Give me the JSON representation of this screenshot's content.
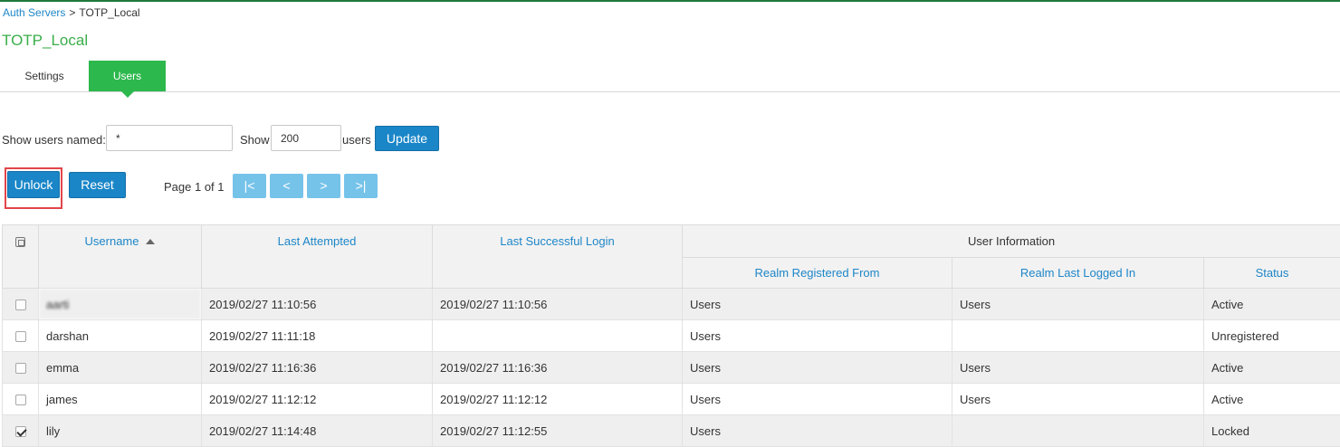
{
  "breadcrumb": {
    "parent": "Auth Servers",
    "separator": ">",
    "current": "TOTP_Local"
  },
  "page_title": "TOTP_Local",
  "tabs": [
    {
      "label": "Settings",
      "active": false
    },
    {
      "label": "Users",
      "active": true
    }
  ],
  "filter": {
    "show_users_named_label": "Show users named:",
    "name_value": "*",
    "show_label": "Show",
    "count_value": "200",
    "users_label": "users",
    "update_button": "Update"
  },
  "actions": {
    "unlock_button": "Unlock",
    "reset_button": "Reset"
  },
  "pager": {
    "text": "Page 1 of 1",
    "first": "|<",
    "prev": "<",
    "next": ">",
    "last": ">|"
  },
  "table": {
    "headers": {
      "username": "Username",
      "last_attempted": "Last Attempted",
      "last_successful_login": "Last Successful Login",
      "user_information": "User Information",
      "realm_registered_from": "Realm Registered From",
      "realm_last_logged_in": "Realm Last Logged In",
      "status": "Status"
    },
    "rows": [
      {
        "checked": false,
        "username": "aarti",
        "last_attempted": "2019/02/27 11:10:56",
        "last_successful": "2019/02/27 11:10:56",
        "realm_registered": "Users",
        "realm_last": "Users",
        "status": "Active"
      },
      {
        "checked": false,
        "username": "darshan",
        "last_attempted": "2019/02/27 11:11:18",
        "last_successful": "",
        "realm_registered": "Users",
        "realm_last": "",
        "status": "Unregistered"
      },
      {
        "checked": false,
        "username": "emma",
        "last_attempted": "2019/02/27 11:16:36",
        "last_successful": "2019/02/27 11:16:36",
        "realm_registered": "Users",
        "realm_last": "Users",
        "status": "Active"
      },
      {
        "checked": false,
        "username": "james",
        "last_attempted": "2019/02/27 11:12:12",
        "last_successful": "2019/02/27 11:12:12",
        "realm_registered": "Users",
        "realm_last": "Users",
        "status": "Active"
      },
      {
        "checked": true,
        "username": "lily",
        "last_attempted": "2019/02/27 11:14:48",
        "last_successful": "2019/02/27 11:12:55",
        "realm_registered": "Users",
        "realm_last": "",
        "status": "Locked"
      }
    ]
  },
  "colors": {
    "accent_green": "#2db84d",
    "title_green": "#3aae49",
    "link_blue": "#1d86c8",
    "button_blue": "#1a86c8",
    "pager_blue": "#76c3ea",
    "highlight_red": "#e2454a"
  }
}
